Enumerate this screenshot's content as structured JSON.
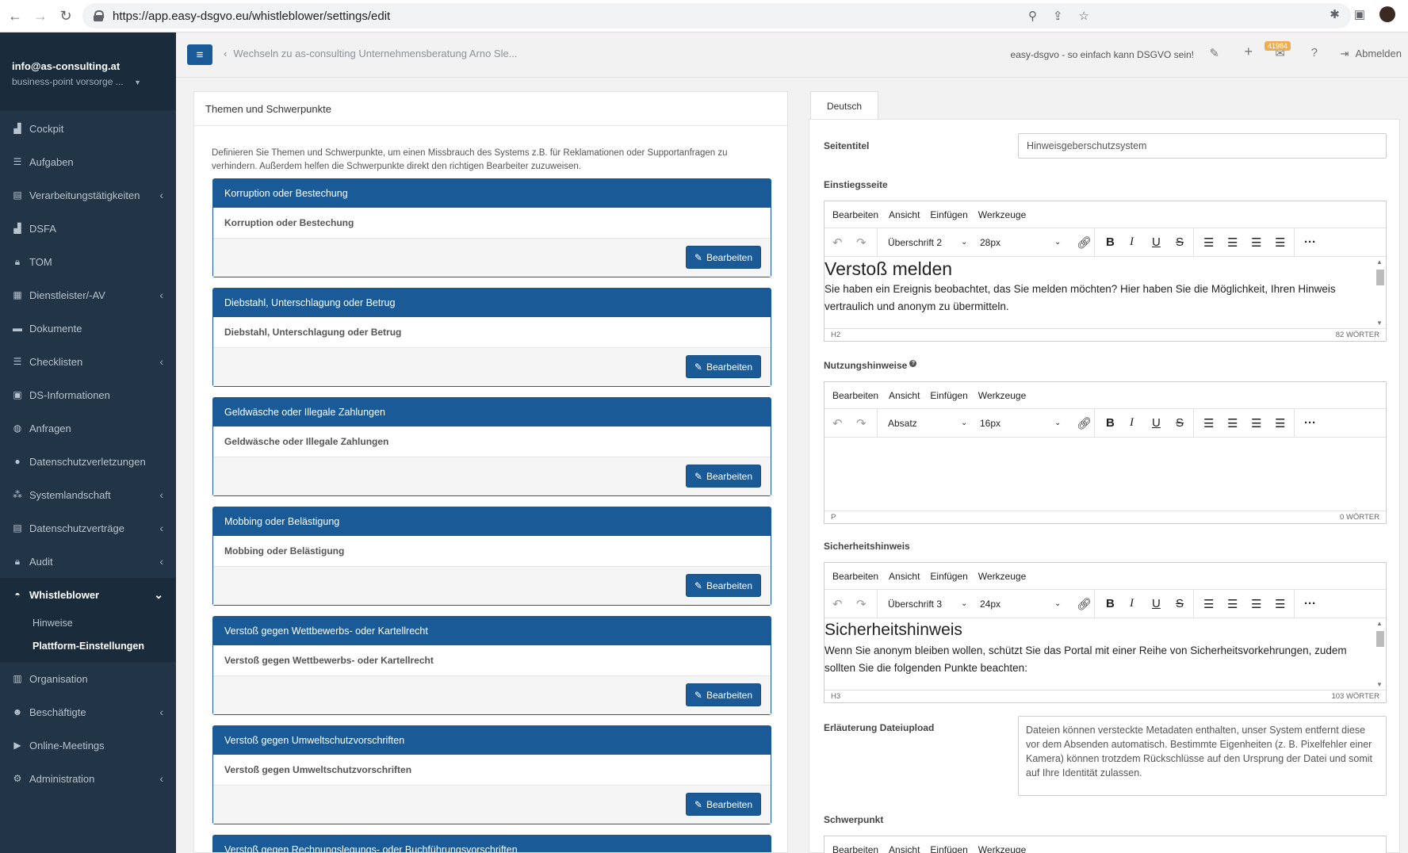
{
  "browser": {
    "url": "https://app.easy-dsgvo.eu/whistleblower/settings/edit"
  },
  "sidebar": {
    "email": "info@as-consulting.at",
    "org": "business-point vorsorge ...",
    "items": [
      {
        "label": "Cockpit",
        "icon": "chart-icon"
      },
      {
        "label": "Aufgaben",
        "icon": "tasks-icon"
      },
      {
        "label": "Verarbeitungstätigkeiten",
        "icon": "list-icon"
      },
      {
        "label": "DSFA",
        "icon": "chart-icon"
      },
      {
        "label": "TOM",
        "icon": "lock-icon"
      },
      {
        "label": "Dienstleister/-AV",
        "icon": "network-icon"
      },
      {
        "label": "Dokumente",
        "icon": "folder-icon"
      },
      {
        "label": "Checklisten",
        "icon": "checklist-icon"
      },
      {
        "label": "DS-Informationen",
        "icon": "info-icon"
      },
      {
        "label": "Anfragen",
        "icon": "chat-icon"
      },
      {
        "label": "Datenschutzverletzungen",
        "icon": "alert-icon"
      },
      {
        "label": "Systemlandschaft",
        "icon": "nodes-icon"
      },
      {
        "label": "Datenschutzverträge",
        "icon": "contract-icon"
      },
      {
        "label": "Audit",
        "icon": "lock-icon"
      },
      {
        "label": "Whistleblower",
        "icon": "whistle-icon"
      },
      {
        "label": "Organisation",
        "icon": "building-icon"
      },
      {
        "label": "Beschäftigte",
        "icon": "users-icon"
      },
      {
        "label": "Online-Meetings",
        "icon": "video-icon"
      },
      {
        "label": "Administration",
        "icon": "cogs-icon"
      }
    ],
    "sub": [
      "Hinweise",
      "Plattform-Einstellungen"
    ]
  },
  "topbar": {
    "switch": "Wechseln zu as-consulting Unternehmensberatung Arno Sle...",
    "tagline": "easy-dsgvo - so einfach kann DSGVO sein!",
    "badge": "41984",
    "logout": "Abmelden"
  },
  "left": {
    "title": "Themen und Schwerpunkte",
    "desc": "Definieren Sie Themen und Schwerpunkte, um einen Missbrauch des Systems z.B. für Reklamationen oder Supportanfragen zu verhindern. Außerdem helfen die Schwerpunkte direkt den richtigen Bearbeiter zuzuweisen.",
    "edit_label": "Bearbeiten",
    "topics": [
      "Korruption oder Bestechung",
      "Diebstahl, Unterschlagung oder Betrug",
      "Geldwäsche oder Illegale Zahlungen",
      "Mobbing oder Belästigung",
      "Verstoß gegen Wettbewerbs- oder Kartellrecht",
      "Verstoß gegen Umweltschutzvorschriften",
      "Verstoß gegen Rechnungslegungs- oder Buchführungsvorschriften"
    ]
  },
  "right": {
    "tab": "Deutsch",
    "seitentitel_label": "Seitentitel",
    "seitentitel_value": "Hinweisgeberschutzsystem",
    "menu": [
      "Bearbeiten",
      "Ansicht",
      "Einfügen",
      "Werkzeuge"
    ],
    "ed1": {
      "label": "Einstiegsseite",
      "format": "Überschrift 2",
      "size": "28px",
      "heading": "Verstoß melden",
      "text": "Sie haben ein Ereignis beobachtet, das Sie melden möchten? Hier haben Sie die Möglichkeit, Ihren Hinweis vertraulich und anonym zu übermitteln.",
      "path": "H2",
      "words": "82 WÖRTER"
    },
    "ed2": {
      "label": "Nutzungshinweise",
      "format": "Absatz",
      "size": "16px",
      "path": "P",
      "words": "0 WÖRTER"
    },
    "ed3": {
      "label": "Sicherheitshinweis",
      "format": "Überschrift 3",
      "size": "24px",
      "heading": "Sicherheitshinweis",
      "text": "Wenn Sie anonym bleiben wollen, schützt Sie das Portal mit einer Reihe von Sicherheitsvorkehrungen, zudem sollten Sie die folgenden Punkte beachten:",
      "path": "H3",
      "words": "103 WÖRTER"
    },
    "upload_label": "Erläuterung Dateiupload",
    "upload_text": "Dateien können versteckte Metadaten enthalten, unser System entfernt diese vor dem Absenden automatisch. Bestimmte Eigenheiten (z. B. Pixelfehler einer Kamera) können trotzdem Rückschlüsse auf den Ursprung der Datei und somit auf Ihre Identität zulassen.",
    "schwerpunkt_label": "Schwerpunkt"
  }
}
